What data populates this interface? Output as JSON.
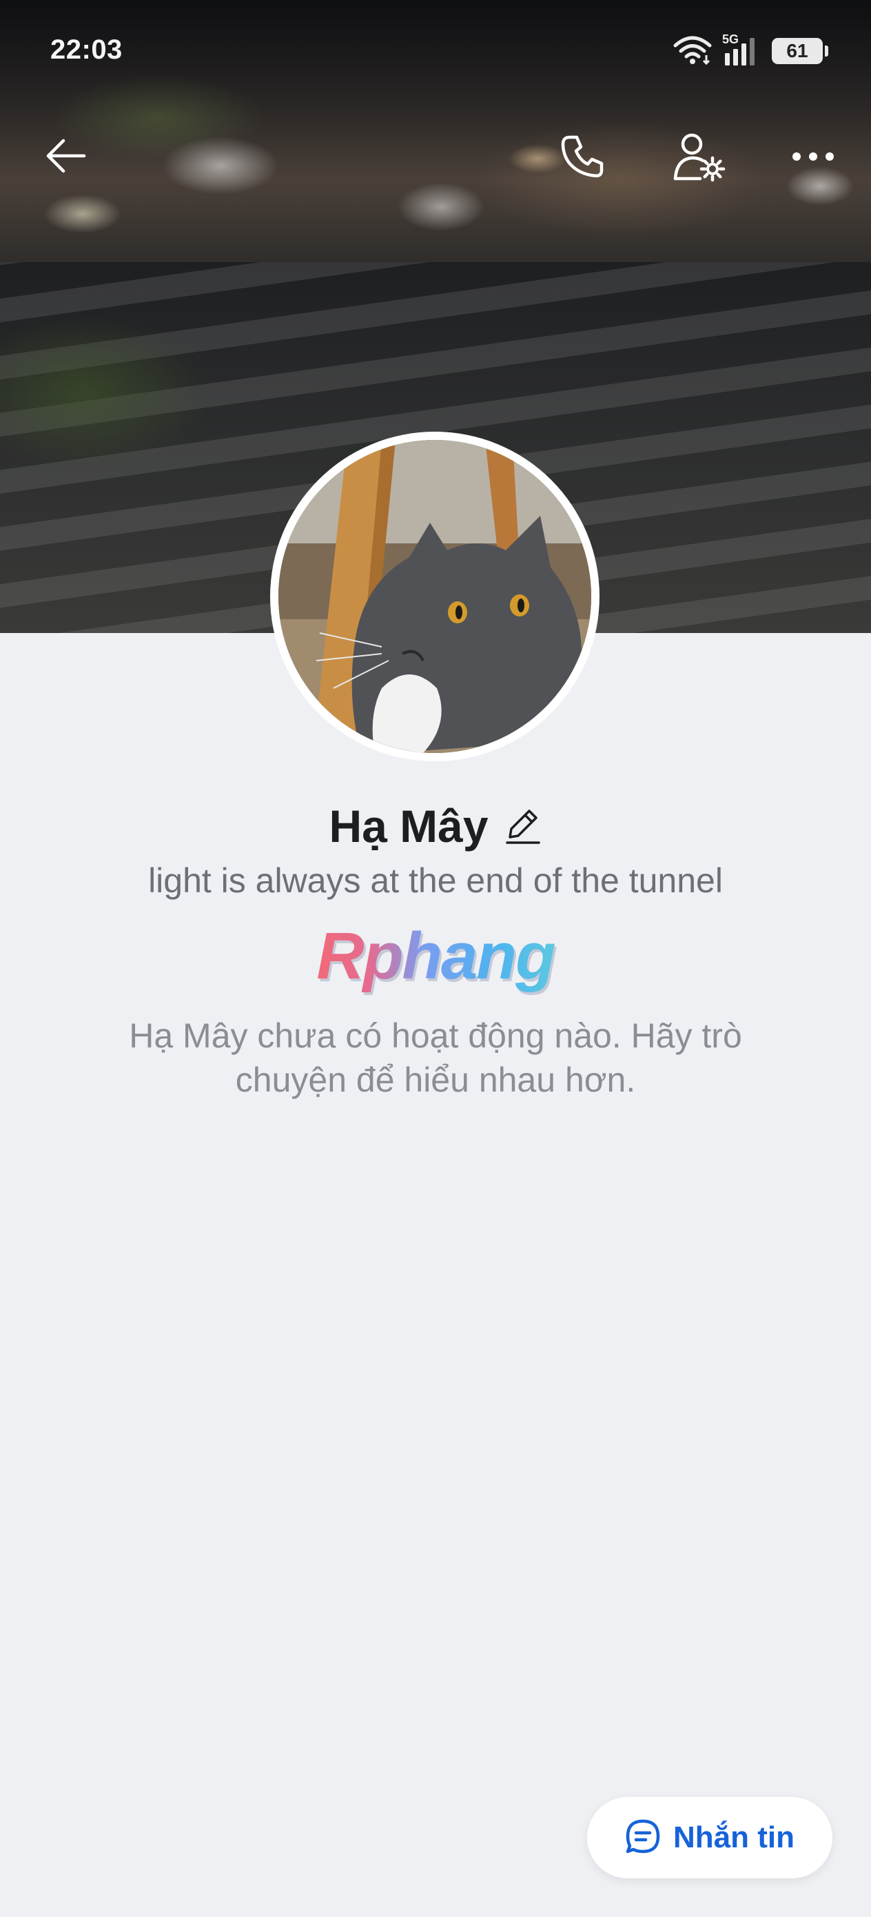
{
  "status_bar": {
    "time": "22:03",
    "network": "5G",
    "battery": "61",
    "icons": [
      "wifi-icon",
      "signal-icon",
      "battery-icon"
    ]
  },
  "top_nav": {
    "icons": [
      "back-arrow-icon",
      "phone-icon",
      "user-settings-icon",
      "more-icon"
    ]
  },
  "profile": {
    "name": "Hạ Mây",
    "status": "light is always at the end of the tunnel",
    "brand_logo": "Rphang",
    "empty_message": "Hạ Mây chưa có hoạt động nào. Hãy trò chuyện để hiểu nhau hơn."
  },
  "actions": {
    "message_label": "Nhắn tin",
    "message_icon": "chat-bubble-icon"
  },
  "colors": {
    "accent": "#1662d9",
    "background": "#eff0f4",
    "name_text": "#1d1e22",
    "secondary_text": "#6c6f75"
  }
}
